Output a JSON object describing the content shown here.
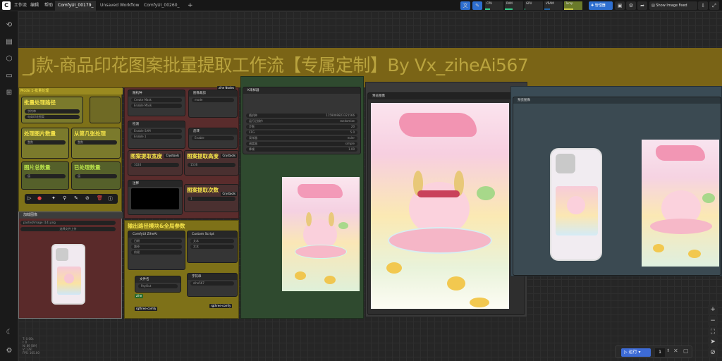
{
  "topbar": {
    "menus": [
      "工作流",
      "编辑",
      "帮助"
    ],
    "tabs": [
      "ComfyUI_00179_",
      "Unsaved Workflow",
      "ComfyUI_00260_"
    ],
    "new_tab": "+",
    "monitors": [
      {
        "label": "CPU",
        "value": 0.25
      },
      {
        "label": "RAM",
        "value": 0.44
      },
      {
        "label": "GPU",
        "value": 0.0
      },
      {
        "label": "VRAM",
        "value": 0.32
      },
      {
        "label": "Temp",
        "value": 0.49
      }
    ],
    "manager_label": "管理器",
    "show_image_feed": "Show Image Feed"
  },
  "canvas": {
    "title": "_J款-商品印花图案批量提取工作流【专属定制】By Vx_ziheAi567",
    "left_group": {
      "header": "Mode 1-批量处理",
      "labels": [
        "批量处理路径",
        "处理图片数量",
        "从第几张处理",
        "图片总数量",
        "已处理数量"
      ]
    },
    "upload_node": {
      "header": "加载图像",
      "file": "pasted/image (14).png",
      "button": "选择文件上传"
    },
    "center_nodes": {
      "labels": [
        "图案提取宽度",
        "图案提取高度",
        "图案提取次数",
        "输出路径模块&全局参数"
      ],
      "badges": [
        "Crystools",
        "Crystools",
        "Crystools"
      ],
      "sub_badges": [
        "zihe Nodes",
        "rgthree-comfy",
        "rgthree-comfy"
      ]
    },
    "sampler": {
      "header": "K采样器",
      "rows": [
        {
          "k": "随机种",
          "v": "1159069823321566"
        },
        {
          "k": "运行后操作",
          "v": "randomize"
        },
        {
          "k": "步数",
          "v": "20"
        },
        {
          "k": "CFG",
          "v": "5.0"
        },
        {
          "k": "采样器",
          "v": "euler"
        },
        {
          "k": "调度器",
          "v": "simple"
        },
        {
          "k": "降噪",
          "v": "1.00"
        }
      ]
    },
    "preview_panels": [
      "预览图像",
      "预览图像"
    ],
    "status": [
      "T: 0.00s",
      "I: 0",
      "N: 89 [89]",
      "V: 178",
      "FPS: 165.00"
    ]
  },
  "runbar": {
    "run_label": "运行",
    "count": "1"
  },
  "colors": {
    "group_yellow": "#8a7a18",
    "group_dark_red": "#5a2a2a",
    "group_green": "#2f4f2f",
    "accent": "#3d6bd6"
  }
}
